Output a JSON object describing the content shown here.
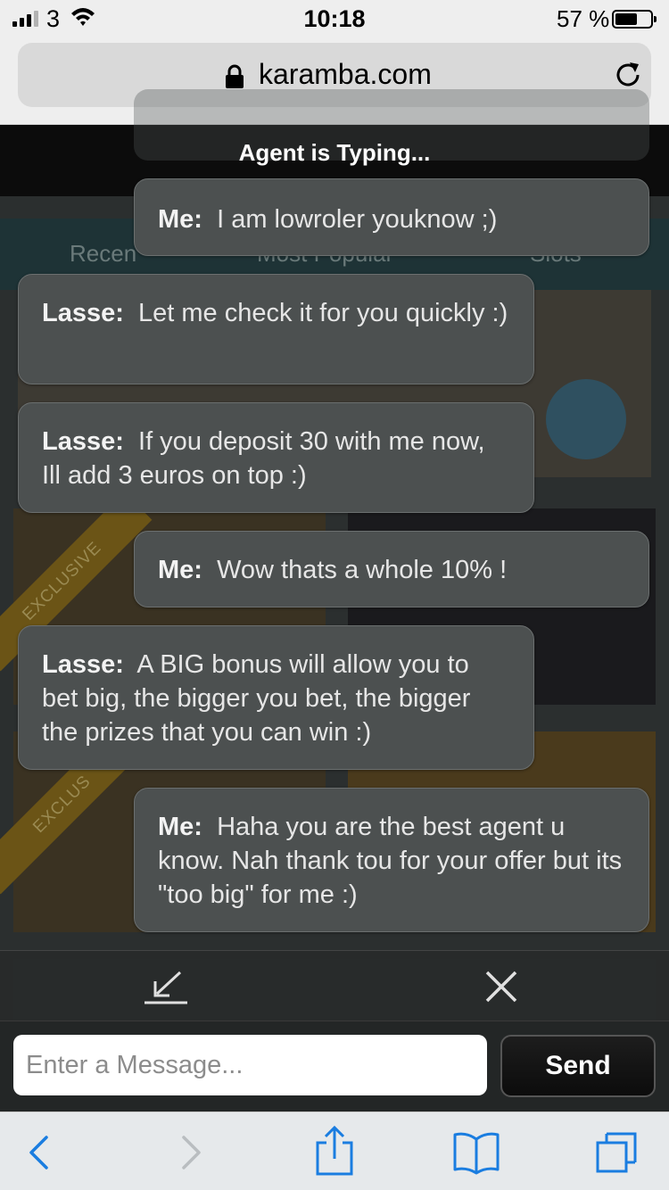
{
  "status_bar": {
    "carrier": "3",
    "time": "10:18",
    "battery_percent": "57 %",
    "battery_level": 0.57,
    "signal_bars": 3
  },
  "browser": {
    "url": "karamba.com",
    "icons": [
      "lock-icon",
      "reload-icon"
    ]
  },
  "background_page": {
    "tabs": [
      "Recen",
      "Most Popular",
      "Slots"
    ],
    "ribbons": [
      "EXCLUSIVE",
      "EXCLUS"
    ]
  },
  "chat": {
    "status": "Agent is Typing...",
    "messages": [
      {
        "sender": "Me:",
        "text": "I am lowroler youknow ;)"
      },
      {
        "sender": "Lasse:",
        "text": "Let me check it for you quickly :)"
      },
      {
        "sender": "Lasse:",
        "text": "If you deposit 30 with me now, Ill add 3 euros on top :)"
      },
      {
        "sender": "Me:",
        "text": "Wow thats a whole 10% !"
      },
      {
        "sender": "Lasse:",
        "text": "A BIG bonus will allow you to bet big, the bigger you bet, the bigger the prizes that you can win :)"
      },
      {
        "sender": "Me:",
        "text": "Haha you are the best agent u know. Nah thank tou for your offer but its \"too big\" for me :)"
      }
    ],
    "controls": {
      "minimize_icon": "minimize-icon",
      "close_icon": "close-icon"
    },
    "input": {
      "placeholder": "Enter a Message...",
      "value": ""
    },
    "send_label": "Send"
  },
  "toolbar": {
    "icons": [
      "back-icon",
      "forward-icon",
      "share-icon",
      "bookmarks-icon",
      "tabs-icon"
    ]
  },
  "colors": {
    "bubble_bg": "#4c5050",
    "chat_header_bg": "#0a0a0a",
    "ios_blue": "#1a7de0",
    "status_bar_bg": "#eeeeee"
  }
}
